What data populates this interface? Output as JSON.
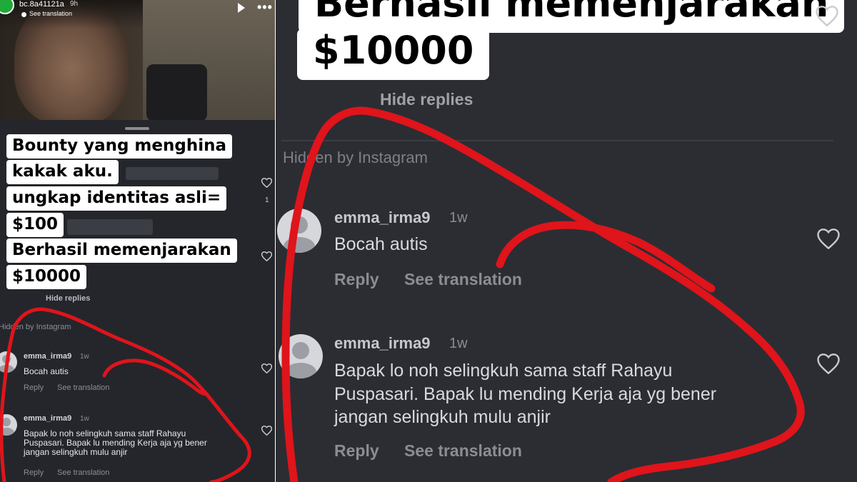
{
  "left": {
    "story": {
      "username": "bc.8a41121a",
      "time": "9h",
      "see_translation": "See translation"
    },
    "caption_lines": [
      "Bounty yang menghina",
      "kakak aku.",
      "ungkap identitas asli=",
      "$100",
      "Berhasil memenjarakan",
      "$10000"
    ],
    "like_count": "1",
    "hide_replies": "Hide replies",
    "hidden_by": "Hidden by Instagram",
    "comments": [
      {
        "username": "emma_irma9",
        "time": "1w",
        "text_lines": [
          "Bocah autis"
        ],
        "reply": "Reply",
        "see_translation": "See translation"
      },
      {
        "username": "emma_irma9",
        "time": "1w",
        "text_lines": [
          "Bapak lo noh selingkuh sama staff Rahayu",
          "Puspasari. Bapak lu mending Kerja aja yg bener",
          "jangan selingkuh mulu anjir"
        ],
        "reply": "Reply",
        "see_translation": "See translation"
      }
    ]
  },
  "right": {
    "caption_lines": [
      "Berhasil memenjarakan",
      "$10000"
    ],
    "hide_replies": "Hide replies",
    "hidden_by": "Hidden by Instagram",
    "comments": [
      {
        "username": "emma_irma9",
        "time": "1w",
        "text_lines": [
          "Bocah autis"
        ],
        "reply": "Reply",
        "see_translation": "See translation"
      },
      {
        "username": "emma_irma9",
        "time": "1w",
        "text_lines": [
          "Bapak lo noh selingkuh sama staff Rahayu",
          "Puspasari. Bapak lu mending Kerja aja yg bener",
          "jangan selingkuh mulu anjir"
        ],
        "reply": "Reply",
        "see_translation": "See translation"
      }
    ]
  },
  "colors": {
    "annotation_red": "#e0141b",
    "caption_bg": "#ffffff",
    "app_bg": "#2b2d33",
    "story_avatar": "#1faa3a"
  },
  "icons": [
    "heart-icon",
    "play-icon",
    "more-icon",
    "avatar-placeholder-icon"
  ]
}
